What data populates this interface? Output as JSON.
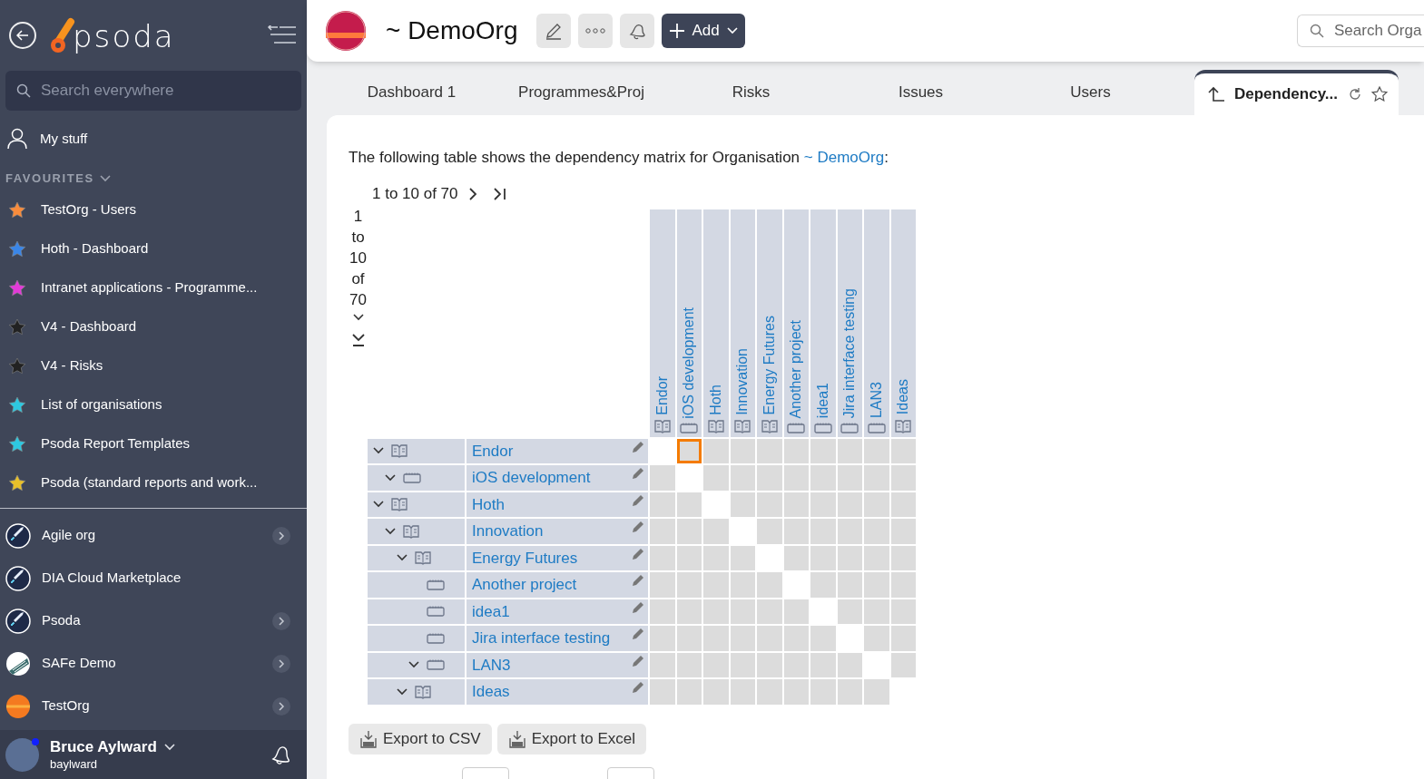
{
  "sidebar": {
    "logo_text": "psoda",
    "search": {
      "placeholder": "Search everywhere"
    },
    "my_stuff": "My stuff",
    "favourites_heading": "FAVOURITES",
    "favourites": [
      {
        "label": "TestOrg - Users",
        "color": "#f98c3c"
      },
      {
        "label": "Hoth - Dashboard",
        "color": "#3a86e8"
      },
      {
        "label": "Intranet applications - Programme...",
        "color": "#e23ad8"
      },
      {
        "label": "V4 - Dashboard",
        "color": "#222222"
      },
      {
        "label": "V4 - Risks",
        "color": "#222222"
      },
      {
        "label": "List of organisations",
        "color": "#2ec8e0"
      },
      {
        "label": "Psoda Report Templates",
        "color": "#2ec8e0"
      },
      {
        "label": "Psoda (standard reports and work...",
        "color": "#e8c02a"
      }
    ],
    "organisations": [
      {
        "label": "Agile org",
        "kind": "rocket",
        "has_arrow": true
      },
      {
        "label": "DIA Cloud Marketplace",
        "kind": "rocket",
        "has_arrow": false
      },
      {
        "label": "Psoda",
        "kind": "rocket",
        "has_arrow": true
      },
      {
        "label": "SAFe Demo",
        "kind": "stripes",
        "has_arrow": true
      },
      {
        "label": "TestOrg",
        "kind": "sunset",
        "has_arrow": true
      }
    ],
    "user": {
      "name": "Bruce Aylward",
      "username": "baylward",
      "online": true
    }
  },
  "header": {
    "title": "~ DemoOrg",
    "add_button": "Add",
    "search": {
      "placeholder": "Search Orga"
    }
  },
  "tabs": [
    {
      "label": "Dashboard 1",
      "selected": false
    },
    {
      "label": "Programmes&Proj",
      "selected": false
    },
    {
      "label": "Risks",
      "selected": false
    },
    {
      "label": "Issues",
      "selected": false
    },
    {
      "label": "Users",
      "selected": false
    },
    {
      "label": "Dependency...",
      "selected": true
    }
  ],
  "content": {
    "intro": "The following table shows the dependency matrix for Organisation ",
    "intro_link": "~ DemoOrg",
    "intro_end": ":",
    "column_pager": "1 to 10 of 70",
    "row_pager": "1 to 10 of 70",
    "columns": [
      {
        "name": "Endor",
        "kind": "programme"
      },
      {
        "name": "iOS development",
        "kind": "project"
      },
      {
        "name": "Hoth",
        "kind": "programme"
      },
      {
        "name": "Innovation",
        "kind": "programme"
      },
      {
        "name": "Energy Futures",
        "kind": "programme"
      },
      {
        "name": "Another project",
        "kind": "project"
      },
      {
        "name": "idea1",
        "kind": "project"
      },
      {
        "name": "Jira interface testing",
        "kind": "project"
      },
      {
        "name": "LAN3",
        "kind": "project"
      },
      {
        "name": "Ideas",
        "kind": "programme"
      }
    ],
    "tree": [
      {
        "name": "Endor",
        "kind": "programme",
        "expanded": true,
        "children": [
          {
            "name": "iOS development",
            "kind": "project",
            "expanded": true
          }
        ]
      },
      {
        "name": "Hoth",
        "kind": "programme",
        "expanded": true,
        "children": [
          {
            "name": "Innovation",
            "kind": "programme",
            "expanded": true,
            "children": [
              {
                "name": "Energy Futures",
                "kind": "programme",
                "expanded": true,
                "children": [
                  {
                    "name": "Another project",
                    "kind": "project"
                  },
                  {
                    "name": "idea1",
                    "kind": "project"
                  },
                  {
                    "name": "Jira interface testing",
                    "kind": "project"
                  },
                  {
                    "name": "LAN3",
                    "kind": "project",
                    "expanded": true
                  }
                ]
              },
              {
                "name": "Ideas",
                "kind": "programme",
                "expanded": true
              }
            ]
          }
        ]
      }
    ],
    "matrix_rows": [
      {
        "cells": [
          {
            "selected": false
          },
          {
            "selected": true
          },
          {
            "selected": false
          },
          {
            "selected": false
          },
          {
            "selected": false
          },
          {
            "selected": false
          },
          {
            "selected": false
          },
          {
            "selected": false
          },
          {
            "selected": false
          },
          {
            "selected": false
          }
        ]
      },
      {
        "cells": [
          {
            "selected": false
          },
          {
            "selected": false
          },
          {
            "selected": false
          },
          {
            "selected": false
          },
          {
            "selected": false
          },
          {
            "selected": false
          },
          {
            "selected": false
          },
          {
            "selected": false
          },
          {
            "selected": false
          },
          {
            "selected": false
          }
        ]
      },
      {
        "cells": [
          {
            "selected": false
          },
          {
            "selected": false
          },
          {
            "selected": false
          },
          {
            "selected": false
          },
          {
            "selected": false
          },
          {
            "selected": false
          },
          {
            "selected": false
          },
          {
            "selected": false
          },
          {
            "selected": false
          },
          {
            "selected": false
          }
        ]
      },
      {
        "cells": [
          {
            "selected": false
          },
          {
            "selected": false
          },
          {
            "selected": false
          },
          {
            "selected": false
          },
          {
            "selected": false
          },
          {
            "selected": false
          },
          {
            "selected": false
          },
          {
            "selected": false
          },
          {
            "selected": false
          },
          {
            "selected": false
          }
        ]
      },
      {
        "cells": [
          {
            "selected": false
          },
          {
            "selected": false
          },
          {
            "selected": false
          },
          {
            "selected": false
          },
          {
            "selected": false
          },
          {
            "selected": false
          },
          {
            "selected": false
          },
          {
            "selected": false
          },
          {
            "selected": false
          },
          {
            "selected": false
          }
        ]
      },
      {
        "cells": [
          {
            "selected": false
          },
          {
            "selected": false
          },
          {
            "selected": false
          },
          {
            "selected": false
          },
          {
            "selected": false
          },
          {
            "selected": false
          },
          {
            "selected": false
          },
          {
            "selected": false
          },
          {
            "selected": false
          },
          {
            "selected": false
          }
        ]
      },
      {
        "cells": [
          {
            "selected": false
          },
          {
            "selected": false
          },
          {
            "selected": false
          },
          {
            "selected": false
          },
          {
            "selected": false
          },
          {
            "selected": false
          },
          {
            "selected": false
          },
          {
            "selected": false
          },
          {
            "selected": false
          },
          {
            "selected": false
          }
        ]
      },
      {
        "cells": [
          {
            "selected": false
          },
          {
            "selected": false
          },
          {
            "selected": false
          },
          {
            "selected": false
          },
          {
            "selected": false
          },
          {
            "selected": false
          },
          {
            "selected": false
          },
          {
            "selected": false
          },
          {
            "selected": false
          },
          {
            "selected": false
          }
        ]
      },
      {
        "cells": [
          {
            "selected": false
          },
          {
            "selected": false
          },
          {
            "selected": false
          },
          {
            "selected": false
          },
          {
            "selected": false
          },
          {
            "selected": false
          },
          {
            "selected": false
          },
          {
            "selected": false
          },
          {
            "selected": false
          },
          {
            "selected": false
          }
        ]
      },
      {
        "cells": [
          {
            "selected": false
          },
          {
            "selected": false
          },
          {
            "selected": false
          },
          {
            "selected": false
          },
          {
            "selected": false
          },
          {
            "selected": false
          },
          {
            "selected": false
          },
          {
            "selected": false
          },
          {
            "selected": false
          },
          {
            "selected": false
          }
        ]
      }
    ],
    "export_buttons": [
      "Export to CSV",
      "Export to Excel"
    ]
  }
}
